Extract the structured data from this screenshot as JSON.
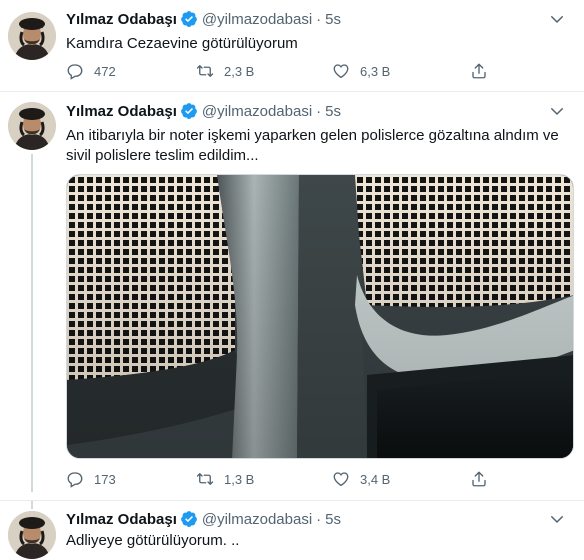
{
  "author": {
    "name": "Yılmaz Odabaşı",
    "handle": "@yilmazodabasi"
  },
  "colors": {
    "accent": "#1d9bf0",
    "secondary_text": "#536471",
    "divider": "#e6ecf0"
  },
  "tweets": [
    {
      "separator": "·",
      "time": "5s",
      "text": "Kamdıra Cezaevine götürülüyorum",
      "replies": "472",
      "retweets": "2,3 B",
      "likes": "6,3 B"
    },
    {
      "separator": "·",
      "time": "5s",
      "text": "An itibarıyla  bir noter işkemi yaparken gelen polislerce gözaltına alndım ve sivil polislere teslim edildim...",
      "replies": "173",
      "retweets": "1,3 B",
      "likes": "3,4 B"
    },
    {
      "separator": "·",
      "time": "5s",
      "text": "Adliyeye götürülüyorum. .."
    }
  ],
  "icons": {
    "reply": "reply-icon",
    "retweet": "retweet-icon",
    "like": "heart-icon",
    "share": "share-icon",
    "verified": "verified-badge-icon",
    "more": "chevron-down-icon"
  }
}
